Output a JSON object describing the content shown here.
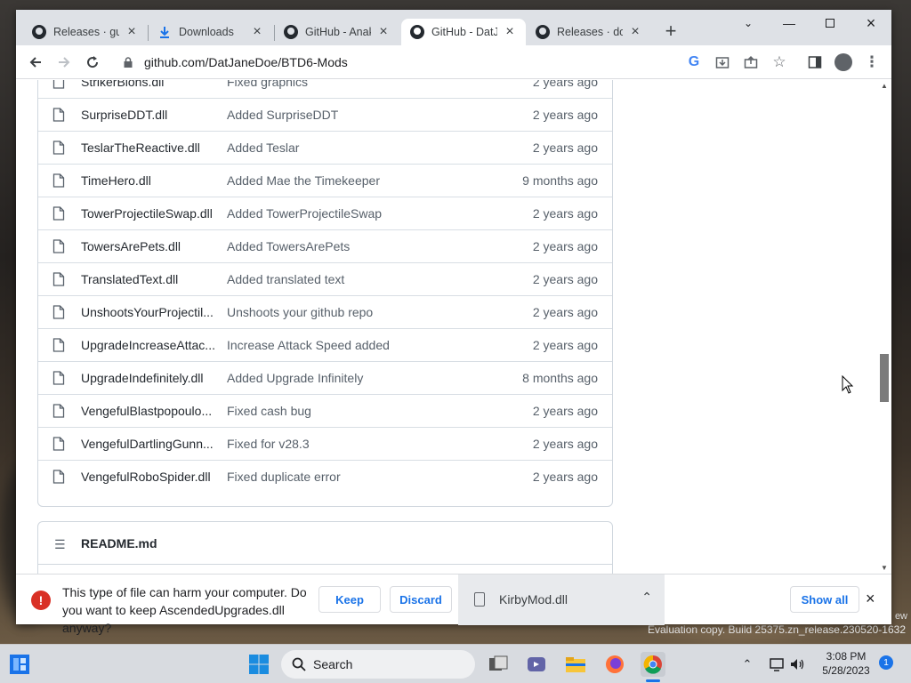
{
  "browser": {
    "tabs": [
      {
        "title": "Releases · gum",
        "icon": "github-icon",
        "active": false
      },
      {
        "title": "Downloads",
        "icon": "download-icon",
        "active": false
      },
      {
        "title": "GitHub - Anak",
        "icon": "github-icon",
        "active": false
      },
      {
        "title": "GitHub - DatJ",
        "icon": "github-icon",
        "active": true
      },
      {
        "title": "Releases · doo",
        "icon": "github-icon",
        "active": false
      }
    ],
    "url": "github.com/DatJaneDoe/BTD6-Mods"
  },
  "files": [
    {
      "name": "StrikerBlons.dll",
      "message": "Fixed graphics",
      "age": "2 years ago"
    },
    {
      "name": "SurpriseDDT.dll",
      "message": "Added SurpriseDDT",
      "age": "2 years ago"
    },
    {
      "name": "TeslarTheReactive.dll",
      "message": "Added Teslar",
      "age": "2 years ago"
    },
    {
      "name": "TimeHero.dll",
      "message": "Added Mae the Timekeeper",
      "age": "9 months ago"
    },
    {
      "name": "TowerProjectileSwap.dll",
      "message": "Added TowerProjectileSwap",
      "age": "2 years ago"
    },
    {
      "name": "TowersArePets.dll",
      "message": "Added TowersArePets",
      "age": "2 years ago"
    },
    {
      "name": "TranslatedText.dll",
      "message": "Added translated text",
      "age": "2 years ago"
    },
    {
      "name": "UnshootsYourProjectil...",
      "message": "Unshoots your github repo",
      "age": "2 years ago"
    },
    {
      "name": "UpgradeIncreaseAttac...",
      "message": "Increase Attack Speed added",
      "age": "2 years ago"
    },
    {
      "name": "UpgradeIndefinitely.dll",
      "message": "Added Upgrade Infinitely",
      "age": "8 months ago"
    },
    {
      "name": "VengefulBlastpopoulo...",
      "message": "Fixed cash bug",
      "age": "2 years ago"
    },
    {
      "name": "VengefulDartlingGunn...",
      "message": "Fixed for v28.3",
      "age": "2 years ago"
    },
    {
      "name": "VengefulRoboSpider.dll",
      "message": "Fixed duplicate error",
      "age": "2 years ago"
    }
  ],
  "readme": {
    "title": "README.md"
  },
  "download_bar": {
    "warning": "This type of file can harm your computer. Do you want to keep AscendedUpgrades.dll anyway?",
    "keep_label": "Keep",
    "discard_label": "Discard",
    "item_filename": "KirbyMod.dll",
    "show_all_label": "Show all"
  },
  "taskbar": {
    "search_label": "Search",
    "time": "3:08 PM",
    "date": "5/28/2023",
    "notification_count": "1"
  },
  "desktop": {
    "watermark": "Evaluation copy. Build 25375.zn_release.230520-1632",
    "watermark_top": "ew"
  },
  "colors": {
    "accent": "#1a73e8",
    "warning": "#d93025",
    "taskbar": "#d8dbe0"
  }
}
